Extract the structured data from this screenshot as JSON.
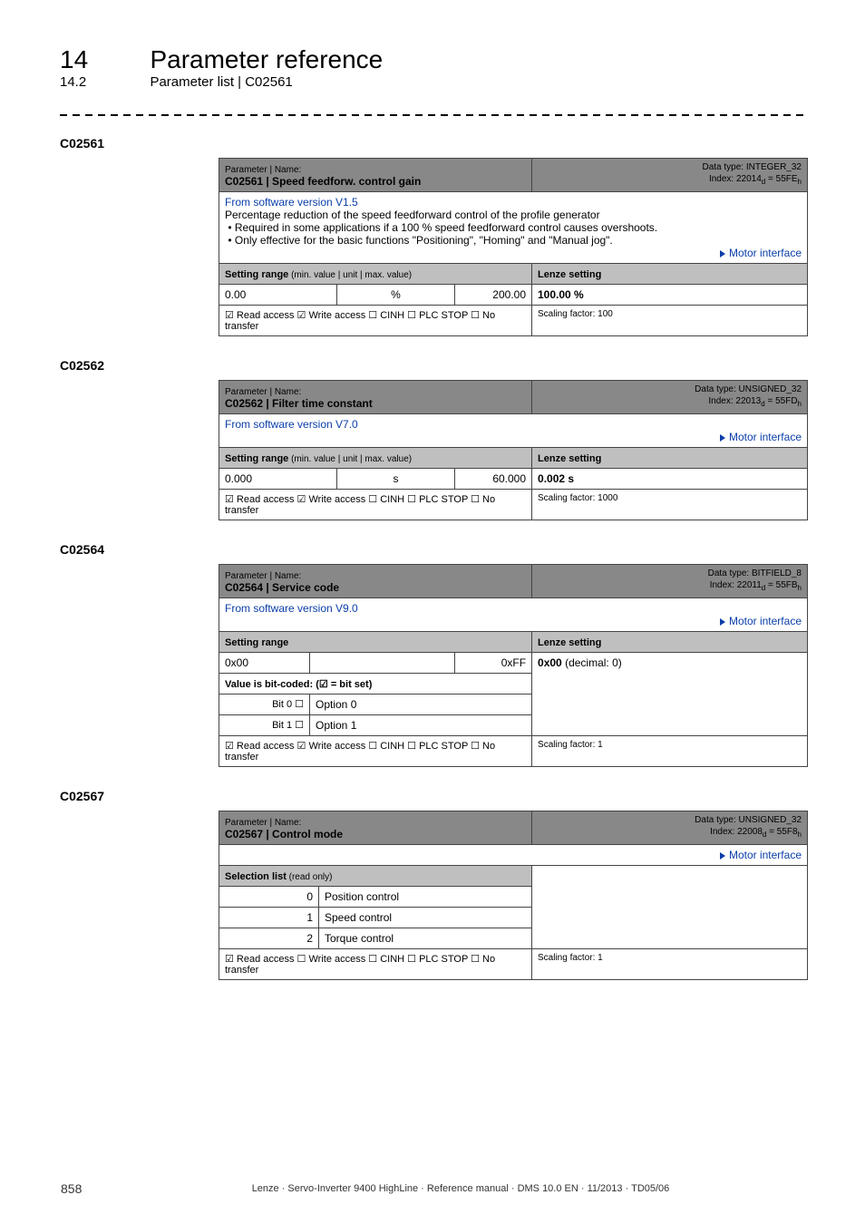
{
  "header": {
    "chapter_num": "14",
    "chapter_title": "Parameter reference",
    "section_num": "14.2",
    "section_title": "Parameter list | C02561"
  },
  "params": [
    {
      "code": "C02561",
      "name_label": "Parameter | Name:",
      "name": "C02561 | Speed feedforw. control gain",
      "dtype": "Data type: INTEGER_32",
      "index": "Index: 22014",
      "index_sub_d": "d",
      "index_eq": " = 55FE",
      "index_sub_h": "h",
      "desc_link": "From software version V1.5",
      "desc_main": "Percentage reduction of the speed feedforward control of the profile generator",
      "bullets": [
        "Required in some applications if a 100 % speed feedforward control causes overshoots.",
        "Only effective for the basic functions \"Positioning\", \"Homing\" and \"Manual jog\"."
      ],
      "motor": "Motor interface",
      "range_hdr": "Setting range",
      "range_hdr_sub": " (min. value | unit | max. value)",
      "lenze_hdr": "Lenze setting",
      "range_min": "0.00",
      "range_unit": "%",
      "range_max": "200.00",
      "lenze_val": "100.00 %",
      "access": "☑ Read access   ☑ Write access   ☐ CINH   ☐ PLC STOP   ☐ No transfer",
      "scaling": "Scaling factor: 100"
    },
    {
      "code": "C02562",
      "name_label": "Parameter | Name:",
      "name": "C02562 | Filter time constant",
      "dtype": "Data type: UNSIGNED_32",
      "index": "Index: 22013",
      "index_sub_d": "d",
      "index_eq": " = 55FD",
      "index_sub_h": "h",
      "desc_link": "From software version V7.0",
      "motor": "Motor interface",
      "range_hdr": "Setting range",
      "range_hdr_sub": " (min. value | unit | max. value)",
      "lenze_hdr": "Lenze setting",
      "range_min": "0.000",
      "range_unit": "s",
      "range_max": "60.000",
      "lenze_val": "0.002 s",
      "access": "☑ Read access   ☑ Write access   ☐ CINH   ☐ PLC STOP   ☐ No transfer",
      "scaling": "Scaling factor: 1000"
    },
    {
      "code": "C02564",
      "name_label": "Parameter | Name:",
      "name": "C02564 | Service code",
      "dtype": "Data type: BITFIELD_8",
      "index": "Index: 22011",
      "index_sub_d": "d",
      "index_eq": " = 55FB",
      "index_sub_h": "h",
      "desc_link": "From software version V9.0",
      "motor": "Motor interface",
      "range_hdr": "Setting range",
      "lenze_hdr": "Lenze setting",
      "range_min": "0x00",
      "range_unit": "",
      "range_max": "0xFF",
      "lenze_val_bold": "0x00",
      "lenze_val_rest": " (decimal: 0)",
      "bitcoded": "Value is bit-coded:  (☑ = bit set)",
      "bits": [
        {
          "bit": "Bit 0 ☐",
          "opt": "Option 0"
        },
        {
          "bit": "Bit 1 ☐",
          "opt": "Option 1"
        }
      ],
      "access": "☑ Read access   ☑ Write access   ☐ CINH   ☐ PLC STOP   ☐ No transfer",
      "scaling": "Scaling factor: 1"
    },
    {
      "code": "C02567",
      "name_label": "Parameter | Name:",
      "name": "C02567 | Control mode",
      "dtype": "Data type: UNSIGNED_32",
      "index": "Index: 22008",
      "index_sub_d": "d",
      "index_eq": " = 55F8",
      "index_sub_h": "h",
      "motor": "Motor interface",
      "sel_hdr": "Selection list",
      "sel_hdr_sub": " (read only)",
      "rows": [
        {
          "n": "0",
          "v": "Position control"
        },
        {
          "n": "1",
          "v": "Speed control"
        },
        {
          "n": "2",
          "v": "Torque control"
        }
      ],
      "access": "☑ Read access   ☐ Write access   ☐ CINH   ☐ PLC STOP   ☐ No transfer",
      "scaling": "Scaling factor: 1"
    }
  ],
  "footer": {
    "page": "858",
    "text": "Lenze · Servo-Inverter 9400 HighLine · Reference manual · DMS 10.0 EN · 11/2013 · TD05/06"
  }
}
